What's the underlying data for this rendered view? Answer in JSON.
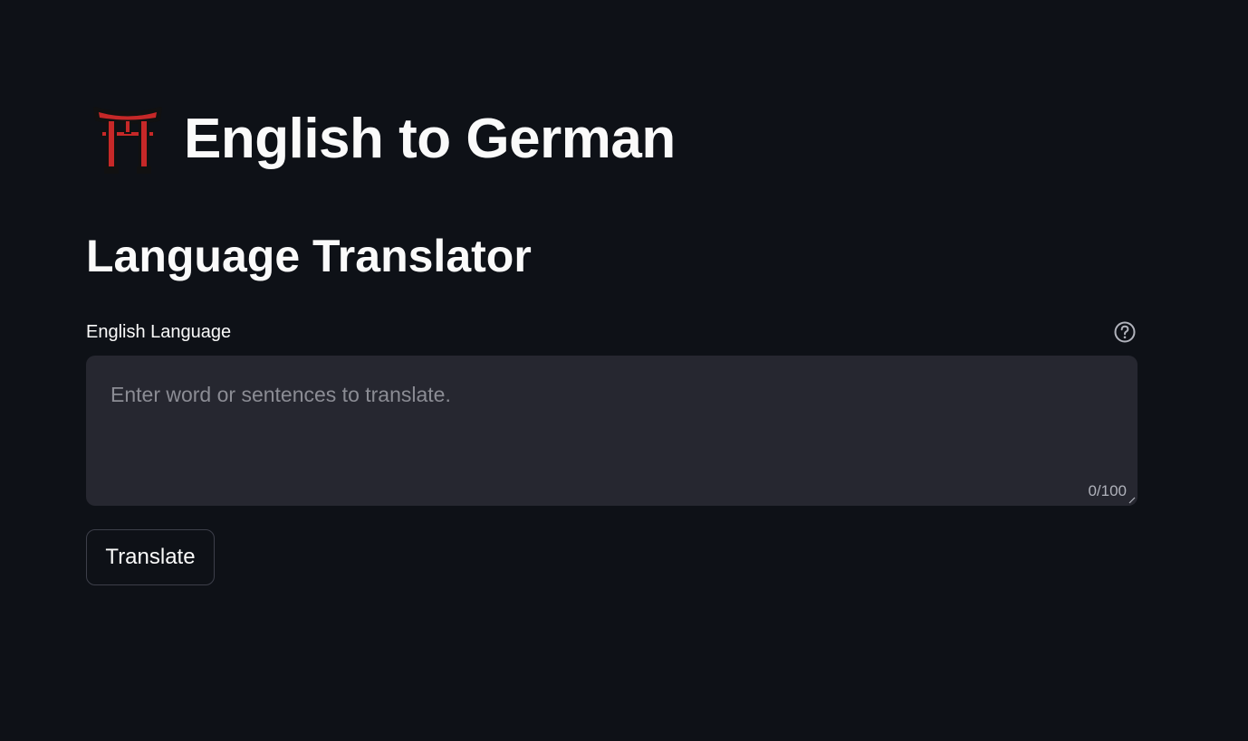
{
  "header": {
    "icon": "torii-gate-icon",
    "title": "English to German"
  },
  "main": {
    "subtitle": "Language Translator",
    "input": {
      "label": "English Language",
      "placeholder": "Enter word or sentences to translate.",
      "value": "",
      "counter": "0/100",
      "help_icon": "help-circle-icon"
    },
    "button": {
      "label": "Translate"
    }
  },
  "colors": {
    "background": "#0e1117",
    "input_background": "#262730",
    "text": "#fafafa",
    "torii_red": "#d32f2f"
  }
}
